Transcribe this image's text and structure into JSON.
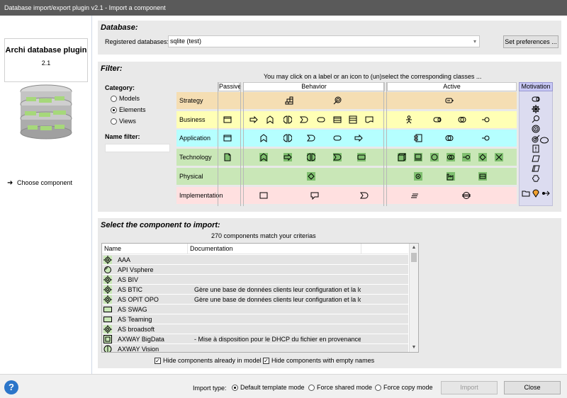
{
  "window": {
    "title": "Database import/export plugin v2.1 - Import a component"
  },
  "sidebar": {
    "plugin_name": "Archi database plugin",
    "plugin_version": "2.1",
    "steps": [
      {
        "label": "Choose component",
        "active": true
      }
    ]
  },
  "database": {
    "title": "Database:",
    "registered_label": "Registered databases:",
    "selected": "sqlite (test)",
    "preferences_button": "Set preferences ..."
  },
  "filter": {
    "title": "Filter:",
    "hint": "You may click on a label or an icon to (un)select the corresponding classes ...",
    "category_label": "Category:",
    "categories": [
      {
        "label": "Models",
        "checked": false
      },
      {
        "label": "Elements",
        "checked": true
      },
      {
        "label": "Views",
        "checked": false
      }
    ],
    "name_filter_label": "Name filter:",
    "name_filter_value": "",
    "columns": {
      "passive": "Passive",
      "behavior": "Behavior",
      "active": "Active",
      "motivation": "Motivation"
    },
    "layers": [
      {
        "label": "Strategy",
        "color": "#f5deb3"
      },
      {
        "label": "Business",
        "color": "#ffffb5"
      },
      {
        "label": "Application",
        "color": "#b5ffff"
      },
      {
        "label": "Technology",
        "color": "#c9e7b7"
      },
      {
        "label": "Physical",
        "color": "#c9e7b7"
      },
      {
        "label": "Implementation",
        "color": "#ffe0e0"
      }
    ]
  },
  "components": {
    "title": "Select the component to import:",
    "match_count": "270 components match your criterias",
    "columns": {
      "name": "Name",
      "documentation": "Documentation"
    },
    "rows": [
      {
        "icon": "node-icon",
        "name": "AAA",
        "doc": ""
      },
      {
        "icon": "application-interface-icon",
        "name": "API Vsphere",
        "doc": ""
      },
      {
        "icon": "node-icon",
        "name": "AS BIV",
        "doc": ""
      },
      {
        "icon": "node-icon",
        "name": "AS BTIC",
        "doc": "Gère une base de données clients leur configuration et la lo..."
      },
      {
        "icon": "node-icon",
        "name": "AS OPIT OPO",
        "doc": "Gère une base de données clients leur configuration et la lo..."
      },
      {
        "icon": "application-service-icon",
        "name": "AS SWAG",
        "doc": ""
      },
      {
        "icon": "application-service-icon",
        "name": "AS Teaming",
        "doc": ""
      },
      {
        "icon": "node-icon",
        "name": "AS broadsoft",
        "doc": ""
      },
      {
        "icon": "technology-artifact-icon",
        "name": "AXWAY BigData",
        "doc": " - Mise à disposition pour le DHCP du fichier en provenance..."
      },
      {
        "icon": "interaction-icon",
        "name": "AXWAY Vision",
        "doc": ""
      }
    ],
    "hide_in_model": {
      "label": "Hide components already in model",
      "checked": true
    },
    "hide_empty_names": {
      "label": "Hide components with empty names",
      "checked": true
    }
  },
  "footer": {
    "import_type_label": "Import type:",
    "modes": [
      {
        "label": "Default template mode",
        "checked": true
      },
      {
        "label": "Force shared mode",
        "checked": false
      },
      {
        "label": "Force copy mode",
        "checked": false
      }
    ],
    "import_button": "Import",
    "close_button": "Close",
    "help": "?"
  }
}
